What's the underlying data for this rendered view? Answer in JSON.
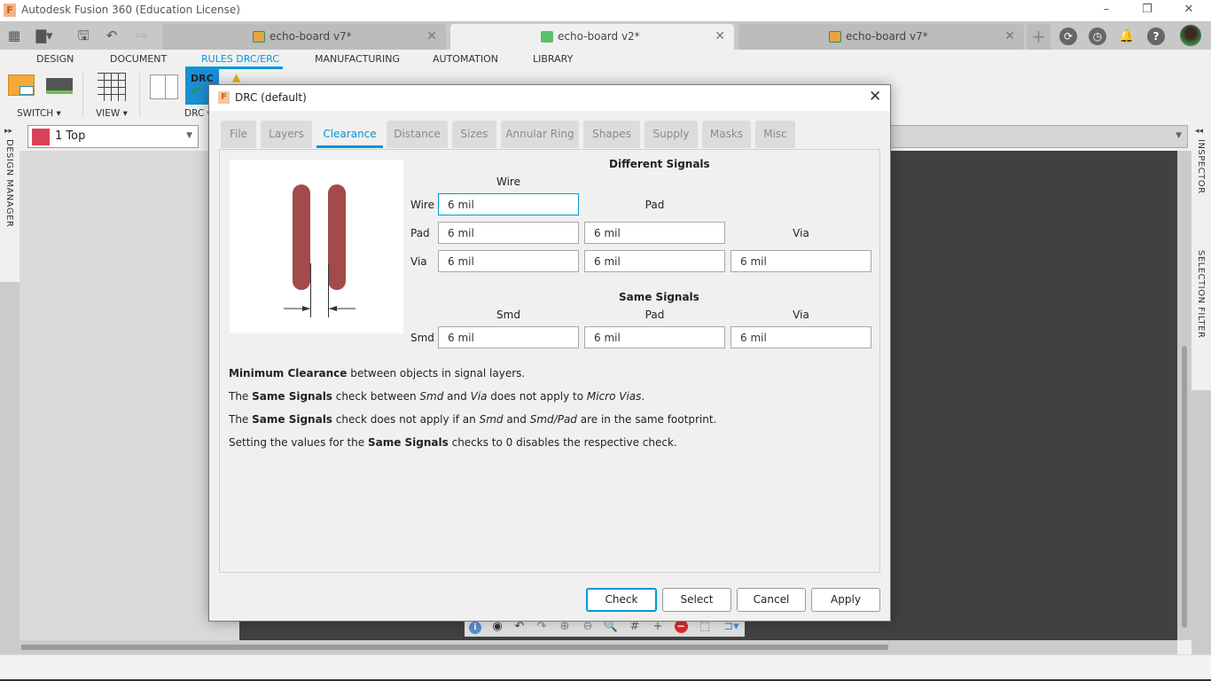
{
  "window": {
    "title": "Autodesk Fusion 360 (Education License)",
    "controls": {
      "minimize": "–",
      "restore": "❐",
      "close": "✕"
    }
  },
  "quick_access": {
    "icons": [
      "grid-menu-icon",
      "file-icon",
      "save-icon",
      "undo-icon",
      "redo-icon"
    ]
  },
  "doc_tabs": [
    {
      "label": "echo-board v7*",
      "icon": "board-icon",
      "active": false
    },
    {
      "label": "echo-board v2*",
      "icon": "schematic-icon",
      "active": true
    },
    {
      "label": "echo-board v7*",
      "icon": "board-icon",
      "active": false
    }
  ],
  "tab_close": "✕",
  "header_right": {
    "add": "+",
    "job_status": "⟳",
    "clock": "◷",
    "notifications": "♠",
    "help": "?"
  },
  "ribbon_tabs": [
    {
      "label": "DESIGN"
    },
    {
      "label": "DOCUMENT"
    },
    {
      "label": "RULES DRC/ERC",
      "active": true
    },
    {
      "label": "MANUFACTURING"
    },
    {
      "label": "AUTOMATION"
    },
    {
      "label": "LIBRARY"
    }
  ],
  "ribbon_groups": {
    "switch": "SWITCH ▾",
    "view": "VIEW ▾",
    "drc": "DRC ▾"
  },
  "drc_button_text": "DRC",
  "layer_selector": {
    "value": "1 Top",
    "color": "#d9415b"
  },
  "side_panels": {
    "left": "DESIGN MANAGER",
    "right_top": "INSPECTOR",
    "right_bottom": "SELECTION FILTER"
  },
  "dialog": {
    "title": "DRC (default)",
    "close": "✕",
    "tabs": [
      {
        "label": "File"
      },
      {
        "label": "Layers"
      },
      {
        "label": "Clearance",
        "active": true
      },
      {
        "label": "Distance"
      },
      {
        "label": "Sizes"
      },
      {
        "label": "Annular Ring"
      },
      {
        "label": "Shapes"
      },
      {
        "label": "Supply"
      },
      {
        "label": "Masks"
      },
      {
        "label": "Misc"
      }
    ],
    "different_signals": {
      "heading": "Different Signals",
      "col_wire": "Wire",
      "col_pad": "Pad",
      "col_via": "Via",
      "row_wire": "Wire",
      "row_pad": "Pad",
      "row_via": "Via",
      "wire_wire": "6 mil",
      "pad_wire": "6 mil",
      "pad_pad": "6 mil",
      "via_wire": "6 mil",
      "via_pad": "6 mil",
      "via_via": "6 mil"
    },
    "same_signals": {
      "heading": "Same Signals",
      "col_smd": "Smd",
      "col_pad": "Pad",
      "col_via": "Via",
      "row_smd": "Smd",
      "smd_smd": "6 mil",
      "smd_pad": "6 mil",
      "smd_via": "6 mil"
    },
    "description": {
      "l1_b": "Minimum Clearance",
      "l1_t": " between objects in signal layers.",
      "l2_a": "The ",
      "l2_b": "Same Signals",
      "l2_c": " check between ",
      "l2_i1": "Smd",
      "l2_d": " and ",
      "l2_i2": "Via",
      "l2_e": " does not apply to ",
      "l2_i3": "Micro Vias",
      "l2_f": ".",
      "l3_a": "The ",
      "l3_b": "Same Signals",
      "l3_c": " check does not apply if an ",
      "l3_i1": "Smd",
      "l3_d": " and ",
      "l3_i2": "Smd/Pad",
      "l3_e": " are in the same footprint.",
      "l4_a": "Setting the values for the ",
      "l4_b": "Same Signals",
      "l4_c": " checks to 0 disables the respective check."
    },
    "buttons": {
      "check": "Check",
      "select": "Select",
      "cancel": "Cancel",
      "apply": "Apply"
    }
  },
  "colors": {
    "accent": "#0696d7",
    "trace": "#a34a4a",
    "canvas": "#414141"
  }
}
